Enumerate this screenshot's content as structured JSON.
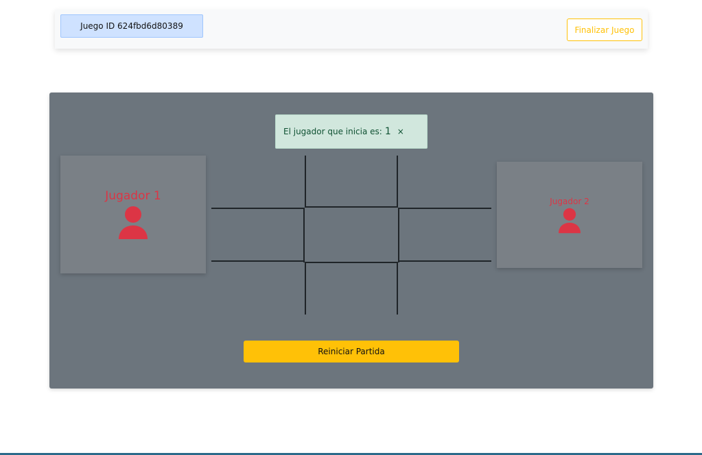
{
  "header": {
    "game_id_label": "Juego ID 624fbd6d80389",
    "end_game_label": "Finalizar Juego"
  },
  "toast": {
    "message": "El jugador que inicia es:",
    "starting_player": "1",
    "close_symbol": "×"
  },
  "players": [
    {
      "name": "Jugador 1",
      "icon": "user-icon"
    },
    {
      "name": "Jugador 2",
      "icon": "user-icon"
    }
  ],
  "board": {
    "cells": [
      "",
      "",
      "",
      "",
      "",
      "",
      "",
      "",
      ""
    ]
  },
  "controls": {
    "restart_label": "Reiniciar Partida"
  },
  "colors": {
    "accent_warning": "#ffc107",
    "player_red": "#dc3545",
    "board_bg": "#6c757d",
    "toast_bg": "#d1e7dd",
    "id_badge_bg": "#cfe2ff"
  }
}
